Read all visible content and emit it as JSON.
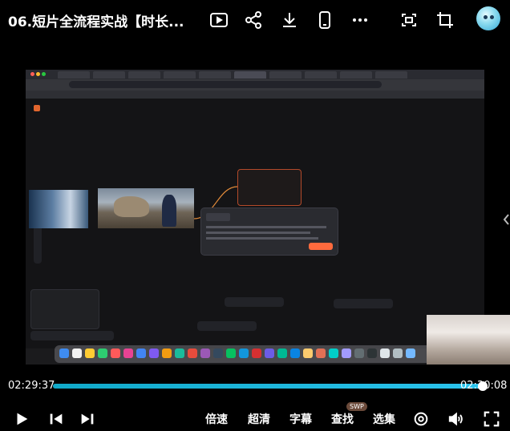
{
  "header": {
    "title": "06.短片全流程实战【时长...",
    "icons": [
      "picture-in-picture-icon",
      "share-icon",
      "download-icon",
      "phone-icon",
      "more-icon",
      "screen-cast-icon",
      "crop-icon"
    ]
  },
  "player": {
    "current_time": "02:29:37",
    "total_time": "02:30:08",
    "progress": 0.992,
    "controls": {
      "speed_label": "倍速",
      "quality_label": "超清",
      "subtitle_label": "字幕",
      "search_label": "查找",
      "search_badge": "SWP",
      "episodes_label": "选集"
    }
  },
  "colors": {
    "progress_accent": "#1fb6dc",
    "background": "#000000"
  }
}
